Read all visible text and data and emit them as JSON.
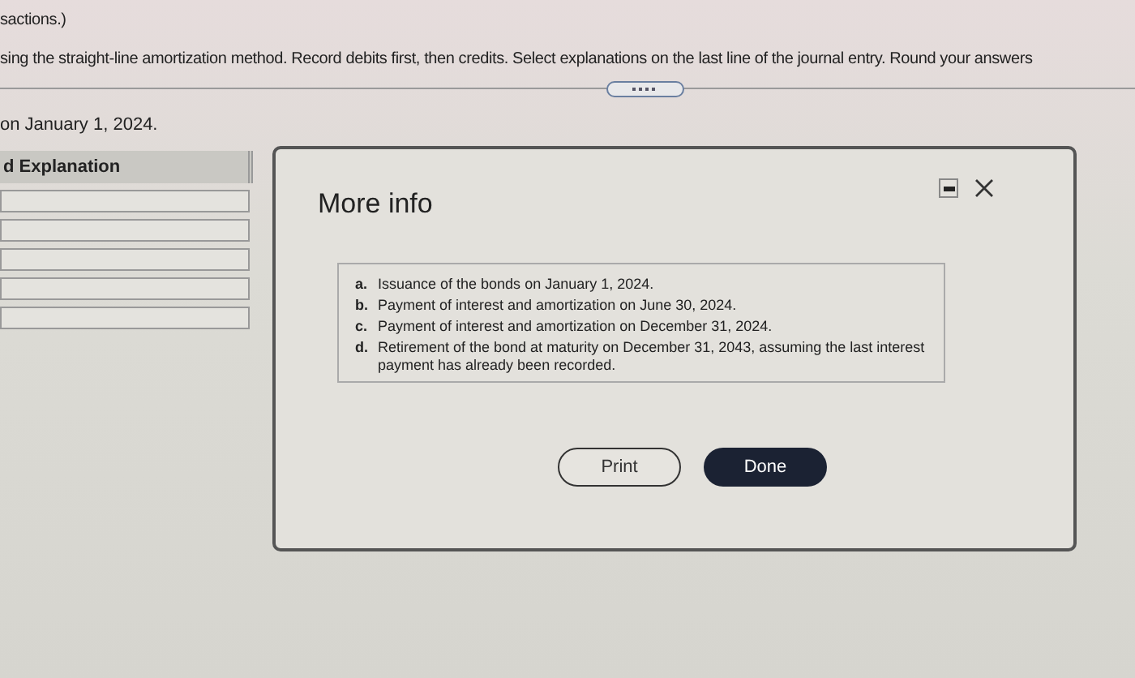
{
  "instructions": [
    "sactions.)",
    "sing the straight-line amortization method. Record debits first, then credits. Select explanations on the last line of the journal entry. Round your answers"
  ],
  "subtitle": "on January 1, 2024.",
  "table": {
    "header": "d Explanation"
  },
  "modal": {
    "title": "More info",
    "items": [
      {
        "letter": "a.",
        "text": "Issuance of the bonds on January 1, 2024."
      },
      {
        "letter": "b.",
        "text": "Payment of interest and amortization on June 30, 2024."
      },
      {
        "letter": "c.",
        "text": "Payment of interest and amortization on December 31, 2024."
      },
      {
        "letter": "d.",
        "text": "Retirement of the bond at maturity on December 31, 2043, assuming the last interest payment has already been recorded."
      }
    ],
    "buttons": [
      {
        "label": "Print",
        "kind": "secondary"
      },
      {
        "label": "Done",
        "kind": "primary"
      }
    ]
  }
}
